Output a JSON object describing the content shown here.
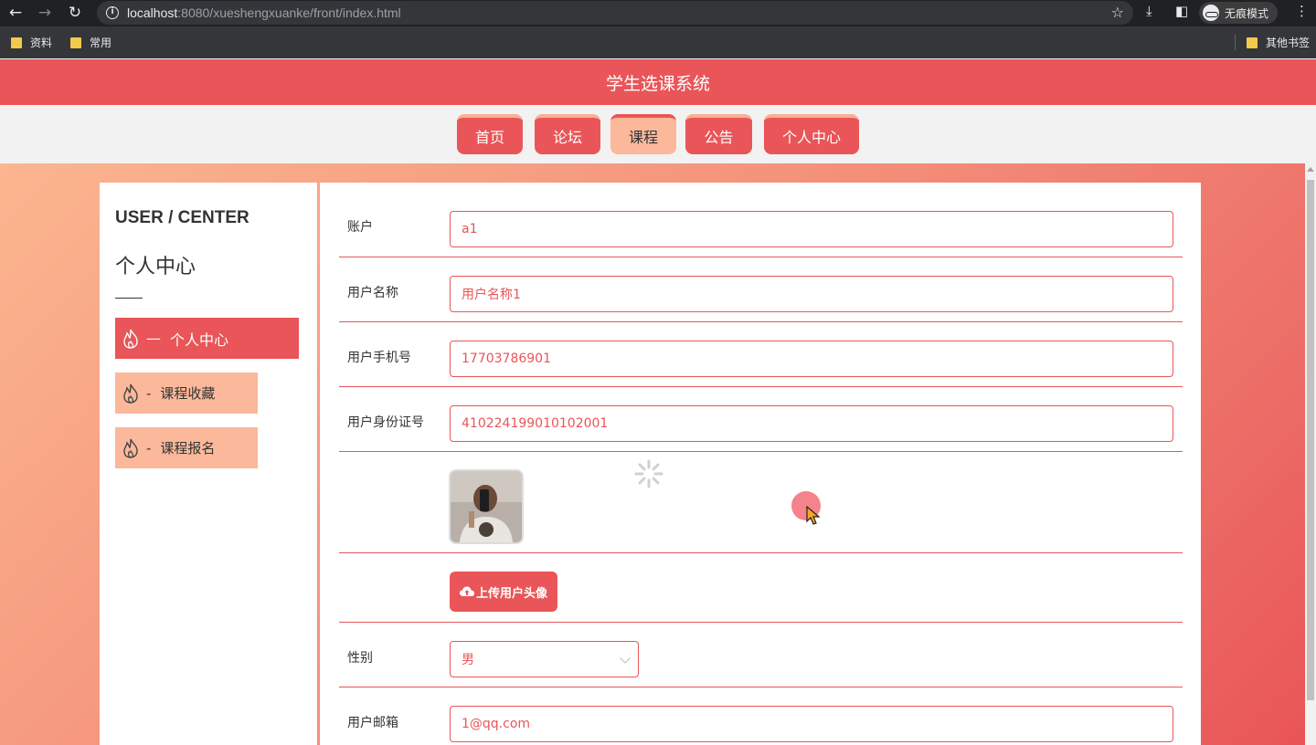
{
  "browser": {
    "url_host": "localhost",
    "url_rest": ":8080/xueshengxuanke/front/index.html",
    "incognito_label": "无痕模式",
    "bookmarks": [
      "资料",
      "常用"
    ],
    "other_bookmarks": "其他书签"
  },
  "site": {
    "title": "学生选课系统",
    "nav": [
      {
        "label": "首页",
        "active": false
      },
      {
        "label": "论坛",
        "active": false
      },
      {
        "label": "课程",
        "active": true
      },
      {
        "label": "公告",
        "active": false
      },
      {
        "label": "个人中心",
        "active": false
      }
    ]
  },
  "sidebar": {
    "title_en": "USER / CENTER",
    "title_cn": "个人中心",
    "items": [
      {
        "label": "个人中心",
        "prefix": "—",
        "active": true
      },
      {
        "label": "课程收藏",
        "prefix": "-",
        "active": false
      },
      {
        "label": "课程报名",
        "prefix": "-",
        "active": false
      }
    ]
  },
  "form": {
    "account": {
      "label": "账户",
      "value": "a1"
    },
    "username": {
      "label": "用户名称",
      "value": "用户名称1"
    },
    "phone": {
      "label": "用户手机号",
      "value": "17703786901"
    },
    "idcard": {
      "label": "用户身份证号",
      "value": "410224199010102001"
    },
    "upload_label": "上传用户头像",
    "gender": {
      "label": "性别",
      "value": "男"
    },
    "email": {
      "label": "用户邮箱",
      "value": "1@qq.com"
    }
  },
  "colors": {
    "primary": "#e95558",
    "secondary": "#fbb89a"
  }
}
